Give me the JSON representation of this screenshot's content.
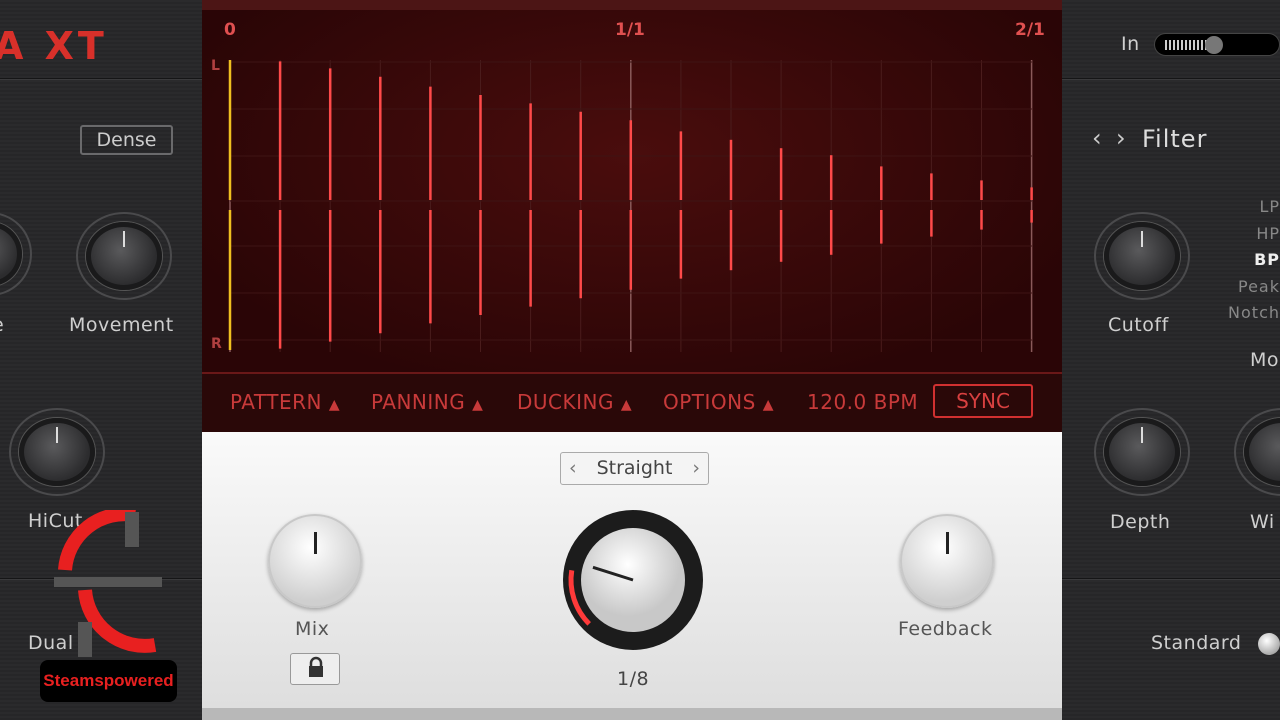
{
  "left_panel": {
    "logo": "A XT",
    "dense_button": "Dense",
    "knobs": [
      {
        "label": "e"
      },
      {
        "label": "Movement"
      },
      {
        "label": "HiCut"
      }
    ],
    "dual_label": "Dual",
    "watermark": "Steamspowered"
  },
  "display": {
    "markers": [
      "0",
      "1/1",
      "2/1"
    ],
    "channel_left": "L",
    "channel_right": "R",
    "tap_levels": [
      1.0,
      0.99,
      0.94,
      0.88,
      0.81,
      0.75,
      0.69,
      0.63,
      0.57,
      0.49,
      0.43,
      0.37,
      0.32,
      0.24,
      0.19,
      0.14,
      0.09
    ],
    "colors": {
      "first_tap": "#f0c020",
      "taps": "#ff4a4a",
      "background": "#3a0809"
    }
  },
  "tabs": {
    "pattern": "PATTERN",
    "panning": "PANNING",
    "ducking": "DUCKING",
    "options": "OPTIONS",
    "bpm": "120.0 BPM",
    "sync": "SYNC",
    "arrow": "▲"
  },
  "controls": {
    "mode_selector": "Straight",
    "prev": "‹",
    "next": "›",
    "mix_label": "Mix",
    "time_value": "1/8",
    "time_level": 0.2,
    "feedback_label": "Feedback",
    "lock_icon": "lock-icon"
  },
  "right_panel": {
    "in_label": "In",
    "filter_title": "Filter",
    "filter_prev": "‹",
    "filter_next": "›",
    "filter_types": [
      "LP",
      "HP",
      "BP",
      "Peak",
      "Notch"
    ],
    "filter_selected": "BP",
    "cutoff_label": "Cutoff",
    "mod_label": "Mo",
    "depth_label": "Depth",
    "width_label": "Wi",
    "standard_label": "Standard"
  }
}
